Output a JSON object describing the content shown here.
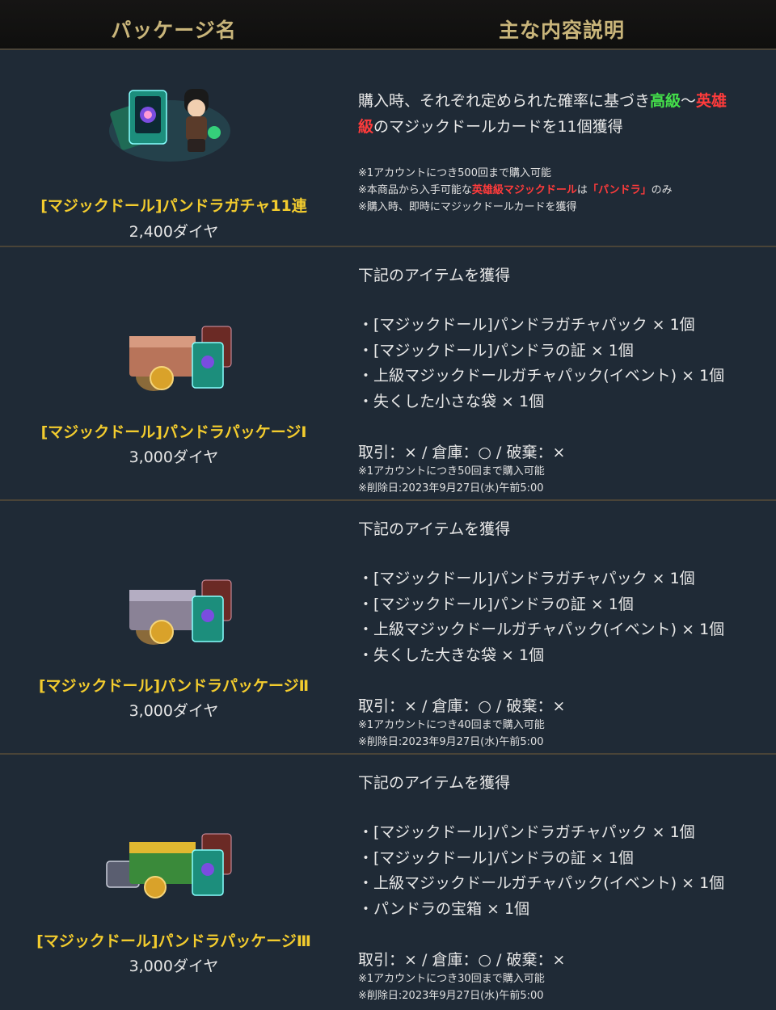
{
  "header": {
    "col1": "パッケージ名",
    "col2": "主な内容説明"
  },
  "rows": [
    {
      "name": "[マジックドール]パンドラガチャ11連",
      "price": "2,400ダイヤ",
      "desc": {
        "l1a": "購入時、それぞれ定められた確率に基づき",
        "l1b": "高級",
        "l1c": "〜",
        "l1d": "英雄",
        "l2a": "級",
        "l2b": "のマジックドールカードを11個獲得"
      },
      "notes": {
        "n1": "※1アカウントにつき500回まで購入可能",
        "n2a": "※本商品から入手可能な",
        "n2b": "英雄級マジックドール",
        "n2c": "は",
        "n2d": "「パンドラ」",
        "n2e": "のみ",
        "n3": "※購入時、即時にマジックドールカードを獲得"
      }
    },
    {
      "name": "[マジックドール]パンドラパッケージⅠ",
      "price": "3,000ダイヤ",
      "intro": "下記のアイテムを獲得",
      "items": [
        "・[マジックドール]パンドラガチャパック × 1個",
        "・[マジックドール]パンドラの証 × 1個",
        "・上級マジックドールガチャパック(イベント) × 1個",
        "・失くした小さな袋 × 1個"
      ],
      "trade": "取引：× / 倉庫：○ / 破棄：×",
      "limit": "※1アカウントにつき50回まで購入可能",
      "delete": "※削除日:2023年9月27日(水)午前5:00"
    },
    {
      "name": "[マジックドール]パンドラパッケージⅡ",
      "price": "3,000ダイヤ",
      "intro": "下記のアイテムを獲得",
      "items": [
        "・[マジックドール]パンドラガチャパック × 1個",
        "・[マジックドール]パンドラの証 × 1個",
        "・上級マジックドールガチャパック(イベント) × 1個",
        "・失くした大きな袋 × 1個"
      ],
      "trade": "取引：× / 倉庫：○ / 破棄：×",
      "limit": "※1アカウントにつき40回まで購入可能",
      "delete": "※削除日:2023年9月27日(水)午前5:00"
    },
    {
      "name": "[マジックドール]パンドラパッケージⅢ",
      "price": "3,000ダイヤ",
      "intro": "下記のアイテムを獲得",
      "items": [
        "・[マジックドール]パンドラガチャパック × 1個",
        "・[マジックドール]パンドラの証 × 1個",
        "・上級マジックドールガチャパック(イベント) × 1個",
        "・パンドラの宝箱 × 1個"
      ],
      "trade": "取引：× / 倉庫：○ / 破棄：×",
      "limit": "※1アカウントにつき30回まで購入可能",
      "delete": "※削除日:2023年9月27日(水)午前5:00"
    }
  ],
  "colors": {
    "name": "#f3cc2e",
    "grade_high": "#44e04a",
    "grade_hero": "#ff3b3b",
    "header_text": "#c9b57a"
  }
}
